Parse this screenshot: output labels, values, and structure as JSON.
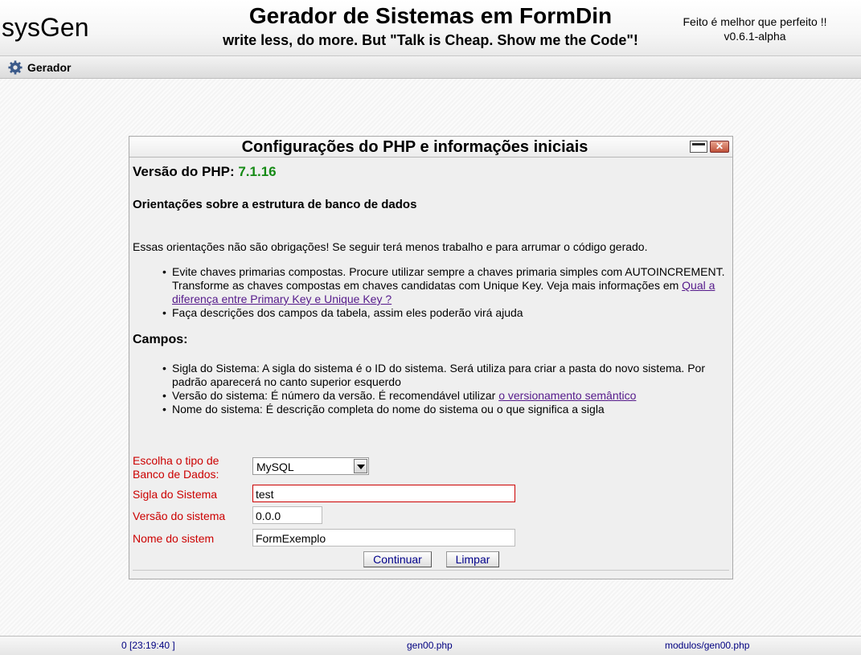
{
  "header": {
    "app_name": "sysGen",
    "title": "Gerador de Sistemas em FormDin",
    "subtitle": "write less, do more. But \"Talk is Cheap. Show me the Code\"!",
    "motto": "Feito é melhor que perfeito !!",
    "version": "v0.6.1-alpha"
  },
  "menu": {
    "items": [
      {
        "label": "Gerador",
        "icon": "gear-icon"
      }
    ]
  },
  "window": {
    "title": "Configurações do PHP e informações iniciais",
    "php_version_label": "Versão do PHP",
    "php_version_colon": ":",
    "php_version_value": "7.1.16",
    "orient_heading": "Orientações sobre a estrutura de banco de dados",
    "intro": "Essas orientações não são obrigações! Se seguir terá menos trabalho e para arrumar o código gerado.",
    "orient_items": {
      "item1_text": "Evite chaves primarias compostas. Procure utilizar sempre a chaves primaria simples com AUTOINCREMENT. Transforme as chaves compostas em chaves candidatas com Unique Key. Veja mais informações em ",
      "item1_link": "Qual a diferença entre Primary Key e Unique Key ?",
      "item2_text": "Faça descrições dos campos da tabela, assim eles poderão virá ajuda"
    },
    "campos_heading": "Campos:",
    "campos_items": {
      "item1_text": "Sigla do Sistema: A sigla do sistema é o ID do sistema. Será utiliza para criar a pasta do novo sistema. Por padrão aparecerá no canto superior esquerdo",
      "item2_text": "Versão do sistema: É número da versão. É recomendável utilizar ",
      "item2_link": "o versionamento semântico",
      "item3_text": "Nome do sistema: É descrição completa do nome do sistema ou o que significa a sigla"
    },
    "form": {
      "db_type_label": "Escolha o tipo de Banco de Dados:",
      "db_type_value": "MySQL",
      "sigla_label": "Sigla do Sistema",
      "sigla_value": "test",
      "versao_label": "Versão do sistema",
      "versao_value": "0.0.0",
      "nome_label": "Nome do sistem",
      "nome_value": "FormExemplo",
      "continue_label": "Continuar",
      "clear_label": "Limpar"
    }
  },
  "footer": {
    "left": "0 [23:19:40 ]",
    "center": "gen00.php",
    "right": "modulos/gen00.php"
  },
  "colors": {
    "php_version": "#158a15",
    "form_label": "#cc0000",
    "link": "#551a8b",
    "footer_text": "#000080"
  }
}
